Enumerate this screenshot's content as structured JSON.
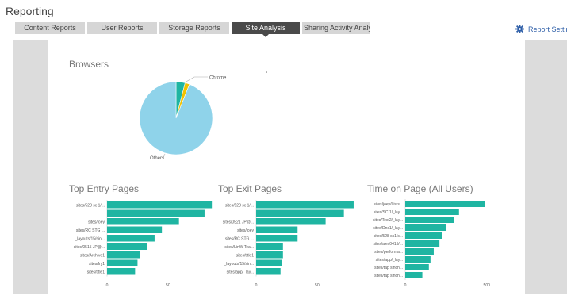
{
  "app": {
    "title": "Reporting"
  },
  "tabs": [
    {
      "label": "Content Reports",
      "active": false
    },
    {
      "label": "User Reports",
      "active": false
    },
    {
      "label": "Storage Reports",
      "active": false
    },
    {
      "label": "Site Analysis",
      "active": true
    },
    {
      "label": "Sharing Activity Analysis",
      "active": false
    }
  ],
  "report_settings": {
    "label": "Report Setting",
    "icon": "gear-icon"
  },
  "colors": {
    "bar": "#1fb5a2",
    "pie_others": "#8fd3ea",
    "pie_chrome": "#1fb5a2",
    "pie_third": "#f2c200",
    "tab_active": "#4a4a4a",
    "tab": "#d6d6d6",
    "link": "#2f5fa8"
  },
  "sections": {
    "browsers": "Browsers",
    "entry": "Top Entry Pages",
    "exit": "Top Exit Pages",
    "time": "Time on Page (All Users)"
  },
  "chart_data": [
    {
      "id": "browsers",
      "type": "pie",
      "title": "Browsers",
      "slices": [
        {
          "label": "Chrome",
          "value": 4
        },
        {
          "label": "",
          "value": 2
        },
        {
          "label": "Others",
          "value": 94
        }
      ]
    },
    {
      "id": "entry",
      "type": "bar",
      "title": "Top Entry Pages",
      "categories": [
        "sites/528 sc 1/...",
        "",
        "sites/joey",
        "sites/RC STG ...",
        "_layouts/15/sin...",
        "sites/0515 JP@...",
        "sites/Archive1",
        "sites/fry1",
        "sites/title1"
      ],
      "values": [
        86,
        80,
        59,
        45,
        39,
        33,
        27,
        25,
        23
      ],
      "ticks": [
        0,
        50
      ],
      "xlim": [
        0,
        95
      ]
    },
    {
      "id": "exit",
      "type": "bar",
      "title": "Top Exit Pages",
      "categories": [
        "sites/528 sc 1/...",
        "",
        "sites/0521 JP@...",
        "sites/joey",
        "sites/RC STG ...",
        "sites/LinW Tea...",
        "sites/title1",
        "_layouts/15/sin...",
        "sites/app/_lay..."
      ],
      "values": [
        80,
        72,
        57,
        34,
        34,
        22,
        22,
        21,
        20
      ],
      "ticks": [
        0,
        50
      ],
      "xlim": [
        0,
        95
      ]
    },
    {
      "id": "time",
      "type": "bar",
      "title": "Time on Page (All Users)",
      "categories": [
        "sites/joey/Lists...",
        "sites/SC 1/_lay...",
        "sites/Test2/_lay...",
        "sites/Dnc1/_lay...",
        "sites/528 sc1/s...",
        "sites/alex0415/...",
        "sites/performa...",
        "sites/app/_lay...",
        "sites/tap sinch...",
        "sites/tap sinch..."
      ],
      "values": [
        490,
        330,
        300,
        250,
        225,
        210,
        175,
        155,
        145,
        105
      ],
      "ticks": [
        0,
        500
      ],
      "xlim": [
        0,
        550
      ]
    }
  ]
}
